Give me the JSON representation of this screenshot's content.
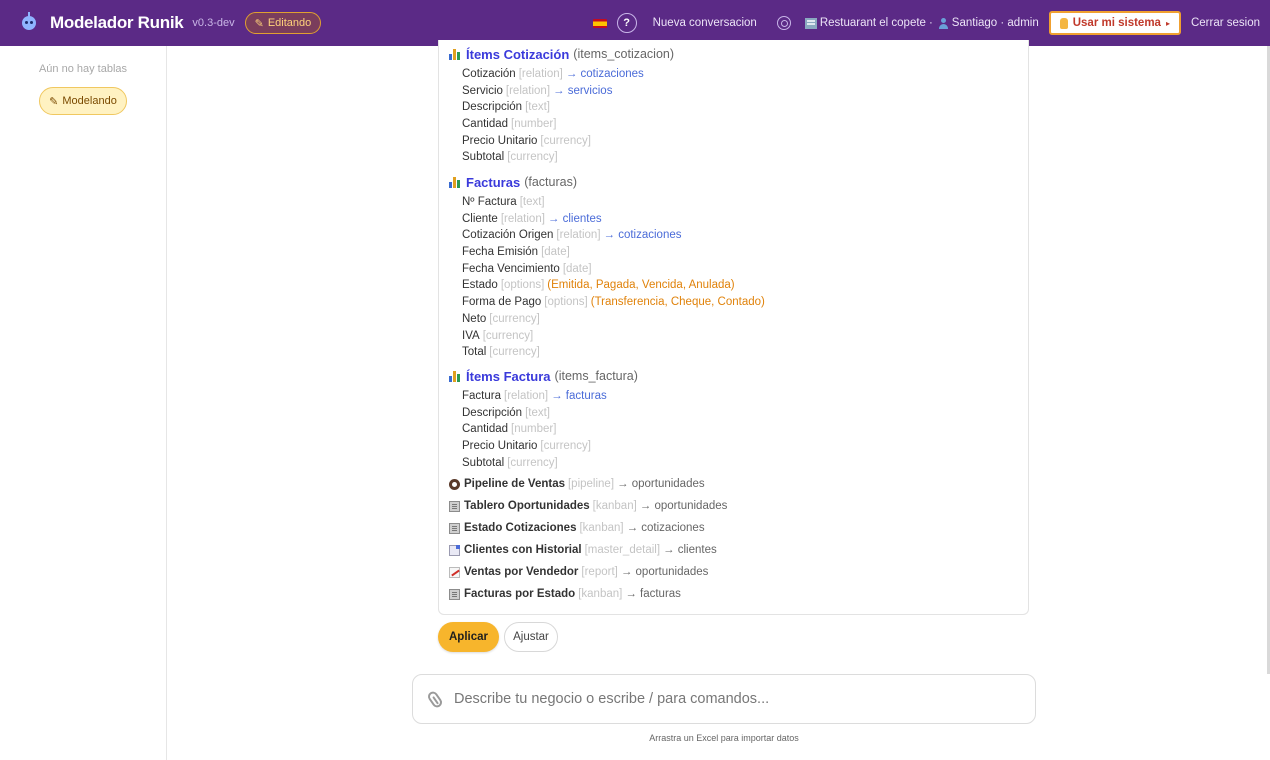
{
  "header": {
    "app_title": "Modelador Runik",
    "version": "v0.3-dev",
    "edit_badge": "Editando",
    "help_label": "?",
    "new_conversation": "Nueva conversacion",
    "context_business": "Restuarant el copete",
    "context_sep": "·",
    "context_user": "Santiago · admin",
    "use_system": "Usar mi sistema",
    "logout": "Cerrar sesion"
  },
  "sidebar": {
    "empty_text": "Aún no hay tablas",
    "mode_label": "Modelando"
  },
  "tables": [
    {
      "name": "Ítems Cotización",
      "key": "(items_cotizacion)",
      "fields": [
        {
          "label": "Cotización",
          "type": "[relation]",
          "rel": "→ cotizaciones"
        },
        {
          "label": "Servicio",
          "type": "[relation]",
          "rel": "→ servicios"
        },
        {
          "label": "Descripción",
          "type": "[text]"
        },
        {
          "label": "Cantidad",
          "type": "[number]"
        },
        {
          "label": "Precio Unitario",
          "type": "[currency]"
        },
        {
          "label": "Subtotal",
          "type": "[currency]"
        }
      ]
    },
    {
      "name": "Facturas",
      "key": "(facturas)",
      "fields": [
        {
          "label": "Nº Factura",
          "type": "[text]"
        },
        {
          "label": "Cliente",
          "type": "[relation]",
          "rel": "→ clientes"
        },
        {
          "label": "Cotización Origen",
          "type": "[relation]",
          "rel": "→ cotizaciones"
        },
        {
          "label": "Fecha Emisión",
          "type": "[date]"
        },
        {
          "label": "Fecha Vencimiento",
          "type": "[date]"
        },
        {
          "label": "Estado",
          "type": "[options]",
          "opts": "(Emitida, Pagada, Vencida, Anulada)"
        },
        {
          "label": "Forma de Pago",
          "type": "[options]",
          "opts": "(Transferencia, Cheque, Contado)"
        },
        {
          "label": "Neto",
          "type": "[currency]"
        },
        {
          "label": "IVA",
          "type": "[currency]"
        },
        {
          "label": "Total",
          "type": "[currency]"
        }
      ]
    },
    {
      "name": "Ítems Factura",
      "key": "(items_factura)",
      "fields": [
        {
          "label": "Factura",
          "type": "[relation]",
          "rel": "→ facturas"
        },
        {
          "label": "Descripción",
          "type": "[text]"
        },
        {
          "label": "Cantidad",
          "type": "[number]"
        },
        {
          "label": "Precio Unitario",
          "type": "[currency]"
        },
        {
          "label": "Subtotal",
          "type": "[currency]"
        }
      ]
    }
  ],
  "views": [
    {
      "icon": "eye-icon",
      "name": "Pipeline de Ventas",
      "type": "[pipeline]",
      "target": "→ oportunidades"
    },
    {
      "icon": "clipboard-icon",
      "name": "Tablero Oportunidades",
      "type": "[kanban]",
      "target": "→ oportunidades"
    },
    {
      "icon": "clipboard-icon",
      "name": "Estado Cotizaciones",
      "type": "[kanban]",
      "target": "→ cotizaciones"
    },
    {
      "icon": "document-icon",
      "name": "Clientes con Historial",
      "type": "[master_detail]",
      "target": "→ clientes"
    },
    {
      "icon": "trend-chart-icon",
      "name": "Ventas por Vendedor",
      "type": "[report]",
      "target": "→ oportunidades"
    },
    {
      "icon": "clipboard-icon",
      "name": "Facturas por Estado",
      "type": "[kanban]",
      "target": "→ facturas"
    }
  ],
  "actions": {
    "apply": "Aplicar",
    "adjust": "Ajustar"
  },
  "chat": {
    "placeholder": "Describe tu negocio o escribe / para comandos...",
    "value": "",
    "hint": "Arrastra un Excel para importar datos"
  },
  "colors": {
    "topbar": "#5b2a86",
    "accent": "#f7b52c",
    "table_title": "#3a3adb",
    "relation": "#4a6bd8",
    "options": "#e0820a"
  }
}
